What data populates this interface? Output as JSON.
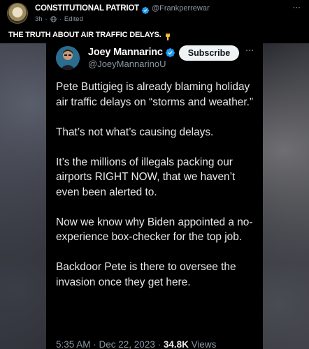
{
  "post": {
    "author_name": "CONSTITUTIONAL PATRIOT",
    "author_handle": "@Frankperrewar",
    "time": "3h",
    "edited_label": "Edited",
    "text": "THE TRUTH ABOUT AIR TRAFFIC DELAYS.",
    "more_label": "···"
  },
  "embed": {
    "author_name": "Joey Mannarinc",
    "author_handle": "@JoeyMannarinoU",
    "subscribe_label": "Subscribe",
    "more_label": "···",
    "paragraphs": [
      "Pete Buttigieg is already blaming holiday air traffic delays on “storms and weather.”",
      "That’s not what’s causing delays.",
      "It’s the millions of illegals packing our airports RIGHT NOW, that we haven’t even been alerted to.",
      "Now we know why Biden appointed a no-experience box-checker for the top job.",
      "Backdoor Pete is there to oversee the invasion once they get here."
    ],
    "footer_time": "5:35 AM · Dec 22, 2023 ·",
    "views_count": "34.8K",
    "views_label": "Views"
  },
  "icons": {
    "verified": "verified-badge-icon",
    "globe": "globe-icon",
    "hand": "pointing-down-hand-icon"
  },
  "colors": {
    "background": "#000000",
    "verified_blue": "#1d9bf0",
    "muted_text": "#8b98a5",
    "subscribe_bg": "#eff3f4"
  }
}
